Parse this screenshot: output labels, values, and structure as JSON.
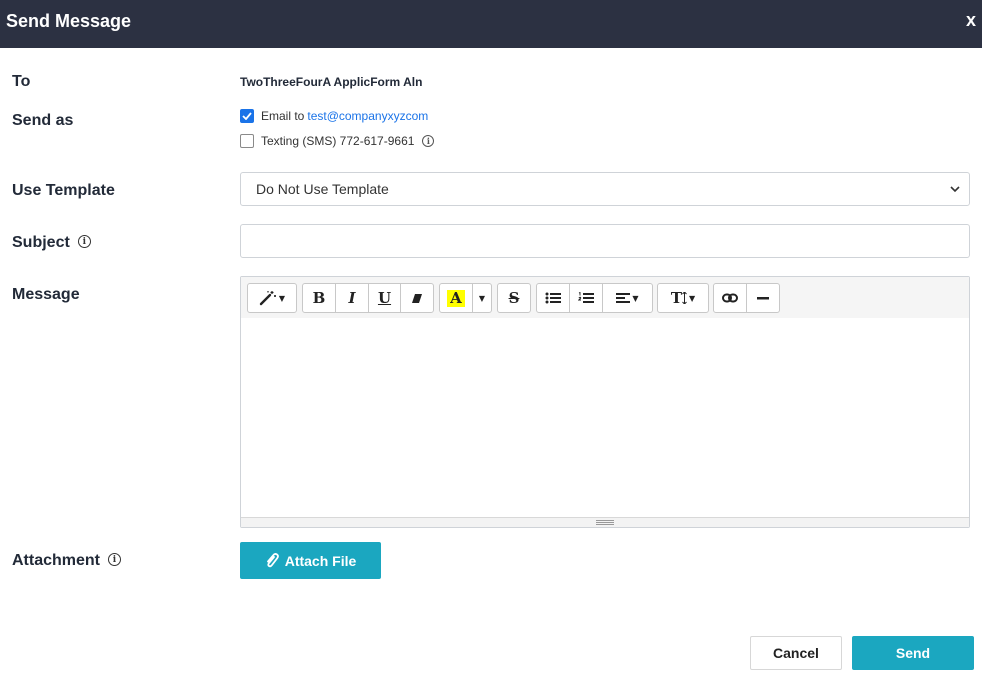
{
  "dialog": {
    "title": "Send Message",
    "close_label": "x"
  },
  "to": {
    "label": "To",
    "value": "TwoThreeFourA ApplicForm Aln"
  },
  "send_as": {
    "label": "Send as",
    "email": {
      "label": "Email to",
      "address": "test@companyxyzcom",
      "checked": true
    },
    "sms": {
      "label": "Texting (SMS) 772-617-9661",
      "checked": false,
      "info_icon": "info-icon"
    }
  },
  "template": {
    "label": "Use Template",
    "selected": "Do Not Use Template"
  },
  "subject": {
    "label": "Subject",
    "value": "",
    "info_icon": "info-icon"
  },
  "message": {
    "label": "Message",
    "toolbar": {
      "bold": "B",
      "italic": "I",
      "underline": "U",
      "highlight": "A",
      "strikethrough": "S",
      "font_size": "T"
    },
    "body": ""
  },
  "attachment": {
    "label": "Attachment",
    "button_label": "Attach File",
    "info_icon": "info-icon"
  },
  "footer": {
    "cancel_label": "Cancel",
    "send_label": "Send"
  },
  "colors": {
    "header_bg": "#2c3142",
    "accent": "#1ba7c0",
    "link": "#1a73e8",
    "highlight": "#ffff00"
  }
}
